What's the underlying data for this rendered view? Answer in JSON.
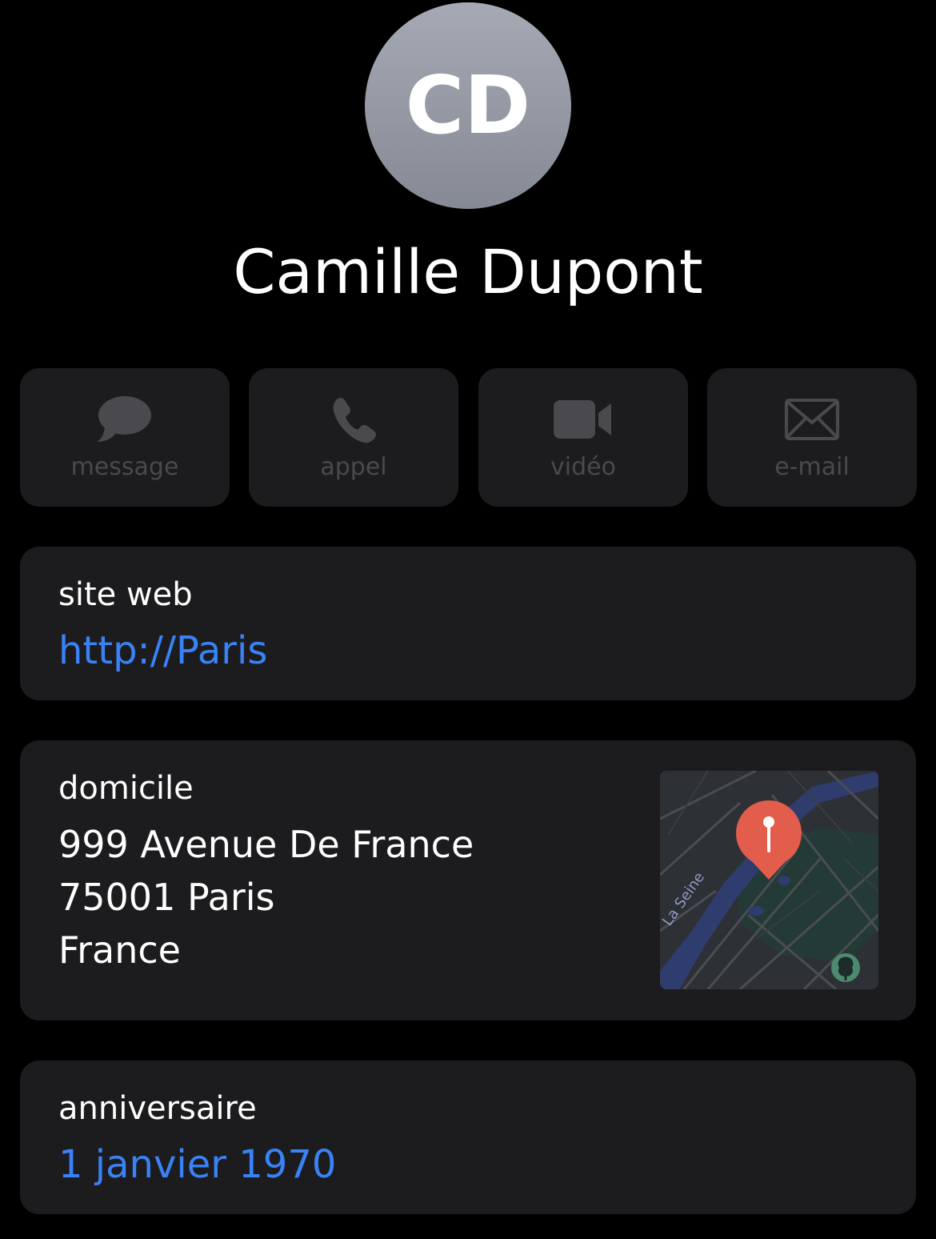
{
  "avatar": {
    "initials": "CD"
  },
  "contact": {
    "name": "Camille Dupont"
  },
  "actions": [
    {
      "label": "message",
      "icon": "message-bubble-icon"
    },
    {
      "label": "appel",
      "icon": "phone-icon"
    },
    {
      "label": "vidéo",
      "icon": "video-camera-icon"
    },
    {
      "label": "e-mail",
      "icon": "envelope-icon"
    }
  ],
  "website": {
    "label": "site web",
    "value": "http://Paris"
  },
  "address": {
    "label": "domicile",
    "line1": "999 Avenue De France",
    "line2": "75001 Paris",
    "line3": "France",
    "map_river_label": "La Seine"
  },
  "birthday": {
    "label": "anniversaire",
    "value": "1 janvier 1970"
  },
  "colors": {
    "background": "#000000",
    "card": "#1c1c1e",
    "link": "#3a82f7",
    "disabled": "#4a4a4e",
    "pin": "#e25d4b"
  }
}
